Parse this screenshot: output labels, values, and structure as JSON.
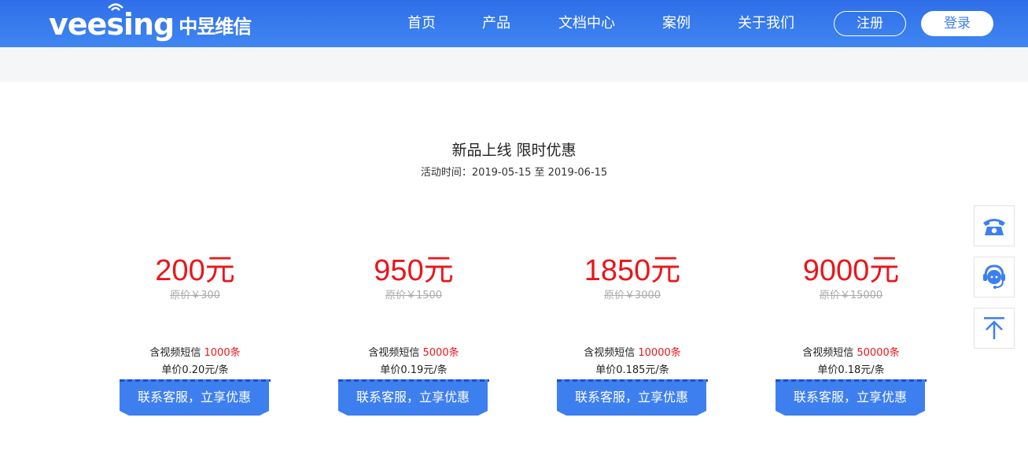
{
  "brand": {
    "name_en": "veesing",
    "name_cn": "中昱维信"
  },
  "nav": [
    {
      "label": "首页"
    },
    {
      "label": "产品"
    },
    {
      "label": "文档中心"
    },
    {
      "label": "案例"
    },
    {
      "label": "关于我们"
    }
  ],
  "auth": {
    "register": "注册",
    "login": "登录"
  },
  "promo": {
    "title": "新品上线 限时优惠",
    "date": "活动时间：2019-05-15 至 2019-06-15"
  },
  "plans": [
    {
      "price": "200元",
      "original": "原价￥300",
      "sms_prefix": "含视频短信 ",
      "sms_count": "1000条",
      "unit": "单价0.20元/条",
      "cta": "联系客服，立享优惠"
    },
    {
      "price": "950元",
      "original": "原价￥1500",
      "sms_prefix": "含视频短信 ",
      "sms_count": "5000条",
      "unit": "单价0.19元/条",
      "cta": "联系客服，立享优惠"
    },
    {
      "price": "1850元",
      "original": "原价￥3000",
      "sms_prefix": "含视频短信 ",
      "sms_count": "10000条",
      "unit": "单价0.185元/条",
      "cta": "联系客服，立享优惠"
    },
    {
      "price": "9000元",
      "original": "原价￥15000",
      "sms_prefix": "含视频短信 ",
      "sms_count": "50000条",
      "unit": "单价0.18元/条",
      "cta": "联系客服，立享优惠"
    }
  ],
  "floating": [
    {
      "icon": "phone-icon"
    },
    {
      "icon": "customer-service-icon"
    },
    {
      "icon": "back-to-top-icon"
    }
  ],
  "colors": {
    "primary": "#3e7ff0",
    "price_red": "#e9161b",
    "header_top": "#2f6ee8",
    "header_bottom": "#3f86f2"
  }
}
